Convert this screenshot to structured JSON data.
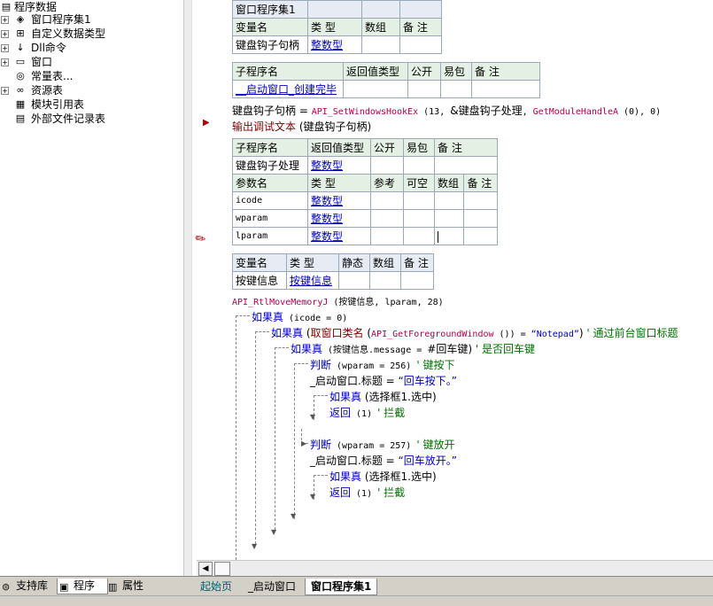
{
  "tree": {
    "root": "程序数据",
    "items": [
      {
        "label": "窗口程序集1",
        "icon": "module-icon"
      },
      {
        "label": "自定义数据类型",
        "icon": "datatype-icon"
      },
      {
        "label": "Dll命令",
        "icon": "dll-icon"
      },
      {
        "label": "窗口",
        "icon": "window-icon"
      },
      {
        "label": "常量表...",
        "icon": "constant-icon"
      },
      {
        "label": "资源表",
        "icon": "resource-icon"
      },
      {
        "label": "模块引用表",
        "icon": "module-ref-icon"
      },
      {
        "label": "外部文件记录表",
        "icon": "file-record-icon"
      }
    ]
  },
  "left_tabs": [
    "支持库",
    "程序",
    "属性"
  ],
  "editor_tabs": [
    "起始页",
    "_启动窗口",
    "窗口程序集1"
  ],
  "assembly_table": {
    "name_row": [
      "窗口程序集1",
      "",
      "",
      ""
    ],
    "var_header": [
      "变量名",
      "类 型",
      "数组",
      "备 注"
    ],
    "var_row": [
      "键盘钩子句柄",
      "整数型",
      "",
      ""
    ]
  },
  "sub1": {
    "header": [
      "子程序名",
      "返回值类型",
      "公开",
      "易包",
      "备 注"
    ],
    "row": [
      "__启动窗口_创建完毕",
      "",
      "",
      "",
      ""
    ]
  },
  "code1": {
    "assign_var": "键盘钩子句柄",
    "assign_eq": " = ",
    "assign_api": "API_SetWindowsHookEx",
    "assign_args_a": " (13, ",
    "assign_arg_ref": "&键盘钩子处理",
    "assign_args_b": ", ",
    "assign_api2": "GetModuleHandleA",
    "assign_args_c": " (0), 0)",
    "debug_cmd": "输出调试文本",
    "debug_args": " (键盘钩子句柄)"
  },
  "sub2": {
    "header": [
      "子程序名",
      "返回值类型",
      "公开",
      "易包",
      "备 注"
    ],
    "row": [
      "键盘钩子处理",
      "整数型",
      "",
      "",
      ""
    ],
    "param_header": [
      "参数名",
      "类 型",
      "参考",
      "可空",
      "数组",
      "备 注"
    ],
    "params": [
      [
        "icode",
        "整数型"
      ],
      [
        "wparam",
        "整数型"
      ],
      [
        "lparam",
        "整数型"
      ]
    ]
  },
  "local_vars": {
    "header": [
      "变量名",
      "类 型",
      "静态",
      "数组",
      "备 注"
    ],
    "row": [
      "按键信息",
      "按键信息",
      "",
      "",
      ""
    ]
  },
  "code2": {
    "l1_api": "API_RtlMoveMemoryJ",
    "l1_args": " (按键信息, lparam, 28)",
    "l2_kw": "如果真",
    "l2_args": " (icode = 0)",
    "l3_kw": "如果真",
    "l3_a": " (",
    "l3_fn": "取窗口类名",
    "l3_b": " (",
    "l3_api": "API_GetForegroundWindow",
    "l3_c": " ()) = ",
    "l3_str": "“Notepad”",
    "l3_d": ")  ",
    "l3_cm": "' 通过前台窗口标题",
    "l4_kw": "如果真",
    "l4_args": " (按键信息.message = ",
    "l4_const": "#回车键",
    "l4_end": ")  ",
    "l4_cm": "' 是否回车键",
    "l5_kw": "判断",
    "l5_args": " (wparam = 256)  ",
    "l5_cm": "' 键按下",
    "l6_a": "_启动窗口.标题 = ",
    "l6_str": "“回车按下。”",
    "l7_kw": "如果真",
    "l7_args": " (选择框1.选中)",
    "l8_kw": "返回",
    "l8_args": " (1)  ",
    "l8_cm": "' 拦截",
    "l9_kw": "判断",
    "l9_args": " (wparam = 257)  ",
    "l9_cm": "' 键放开",
    "l10_a": "_启动窗口.标题 = ",
    "l10_str": "“回车放开。”",
    "l11_kw": "如果真",
    "l11_args": " (选择框1.选中)",
    "l12_kw": "返回",
    "l12_args": " (1)  ",
    "l12_cm": "' 拦截"
  }
}
